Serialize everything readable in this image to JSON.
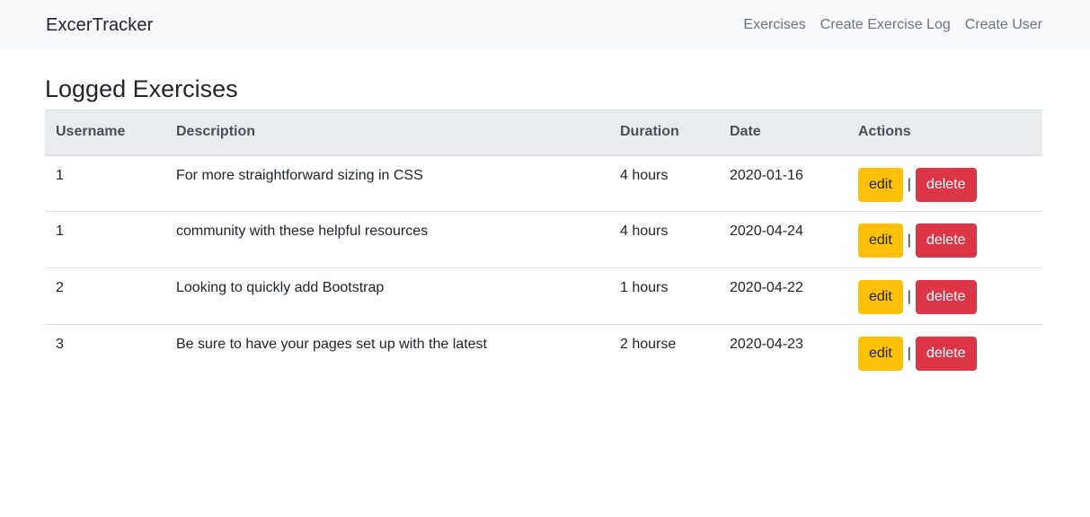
{
  "nav": {
    "brand": "ExcerTracker",
    "links": [
      "Exercises",
      "Create Exercise Log",
      "Create User"
    ]
  },
  "page": {
    "title": "Logged Exercises"
  },
  "table": {
    "headers": [
      "Username",
      "Description",
      "Duration",
      "Date",
      "Actions"
    ],
    "rows": [
      {
        "username": "1",
        "description": "For more straightforward sizing in CSS",
        "duration": "4 hours",
        "date": "2020-01-16"
      },
      {
        "username": "1",
        "description": "community with these helpful resources",
        "duration": "4 hours",
        "date": "2020-04-24"
      },
      {
        "username": "2",
        "description": "Looking to quickly add Bootstrap",
        "duration": "1 hours",
        "date": "2020-04-22"
      },
      {
        "username": "3",
        "description": "Be sure to have your pages set up with the latest",
        "duration": "2 hourse",
        "date": "2020-04-23"
      }
    ],
    "edit_label": "edit",
    "separator": "|",
    "delete_label": "delete"
  },
  "colors": {
    "edit": "#ffc107",
    "delete": "#dc3545",
    "navbar": "#f8f9fa",
    "header_row": "#e9ecef"
  }
}
